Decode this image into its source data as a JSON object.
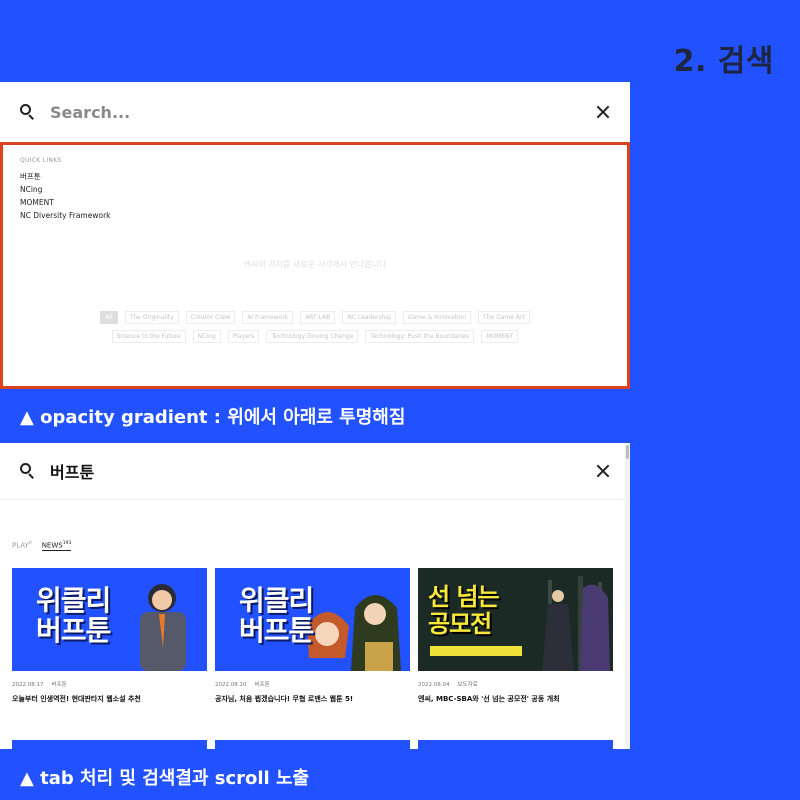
{
  "header": {
    "title": "2. 검색"
  },
  "panel1": {
    "search": {
      "placeholder": "Search..."
    },
    "quick_links": {
      "title": "QUICK LINKS",
      "items": [
        "버프툰",
        "NCing",
        "MOMENT",
        "NC Diversity Framework"
      ]
    },
    "faded_message": "엔씨의 가치를 새로운 시각에서 만나봅니다",
    "tags_row1": [
      "All",
      "The Originality",
      "Creator Crew",
      "AI Framework",
      "ART LAB",
      "NC Leadership",
      "Game & Innovation",
      "The Game Art"
    ],
    "tags_row2": [
      "Science to the Future",
      "NCing",
      "Players",
      "Technology Driving Change",
      "Technology: Push the Boundaries",
      "MOMENT"
    ],
    "active_tag": "All"
  },
  "caption1": "▲ opacity gradient : 위에서 아래로 투명해짐",
  "panel2": {
    "search": {
      "query": "버프툰"
    },
    "tabs": [
      {
        "label": "PLAY",
        "count": "0",
        "active": false
      },
      {
        "label": "NEWS",
        "count": "193",
        "active": true
      }
    ],
    "cards": [
      {
        "date": "2022.08.17",
        "category": "버프툰",
        "title": "오늘부터 인생역전! 현대판타지 웹소설 추천",
        "thumb_text": "위클리\n버프툰",
        "thumb_style": "blue"
      },
      {
        "date": "2022.08.10",
        "category": "버프툰",
        "title": "공자님, 처음 뵙겠습니다! 무협 로맨스 웹툰 5!",
        "thumb_text": "위클리\n버프툰",
        "thumb_style": "blue"
      },
      {
        "date": "2022.08.04",
        "category": "보도자료",
        "title": "엔씨, MBC-SBA와 '선 넘는 공모전' 공동 개최",
        "thumb_text": "선 넘는\n공모전",
        "thumb_style": "dark"
      }
    ]
  },
  "caption2": "▲ tab 처리 및 검색결과 scroll 노출",
  "colors": {
    "background": "#2251ff",
    "highlight": "#d9431e",
    "caption": "#ffffff"
  }
}
